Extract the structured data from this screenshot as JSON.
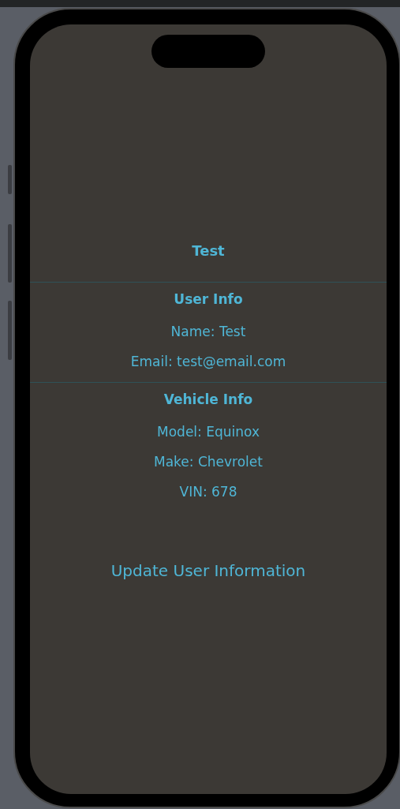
{
  "title": "Test",
  "sections": [
    {
      "heading": "User Info",
      "fields": [
        "Name: Test",
        "Email: test@email.com"
      ]
    },
    {
      "heading": "Vehicle Info",
      "fields": [
        "Model: Equinox",
        "Make: Chevrolet",
        "VIN: 678"
      ]
    }
  ],
  "update_button": "Update User Information"
}
